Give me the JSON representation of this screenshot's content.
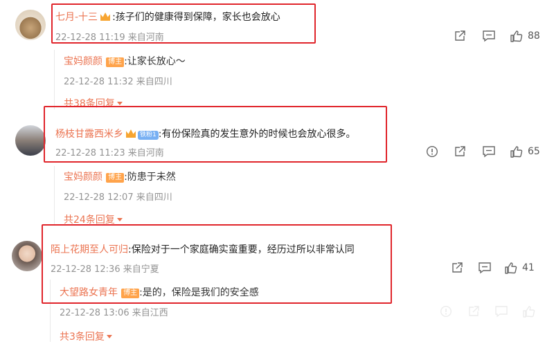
{
  "comments": [
    {
      "user": "七月-十三",
      "text": ":孩子们的健康得到保障，家长也会放心",
      "meta": "22-12-28 11:19 来自河南",
      "likes": "88",
      "reply": {
        "user": "宝妈颜颜",
        "badge": "博主",
        "text": ":让家长放心～",
        "meta": "22-12-28 11:32 来自四川"
      },
      "more": "共38条回复"
    },
    {
      "user": "杨枝甘露西米乡",
      "fan_badge": "铁粉1",
      "text": ":有份保险真的发生意外的时候也会放心很多。",
      "meta": "22-12-28 11:23 来自河南",
      "likes": "65",
      "reply": {
        "user": "宝妈颜颜",
        "badge": "博主",
        "text": ":防患于未然",
        "meta": "22-12-28 12:07 来自四川"
      },
      "more": "共24条回复"
    },
    {
      "user": "陌上花期至人可归",
      "text": ":保险对于一个家庭确实蛮重要，经历过所以非常认同",
      "meta": "22-12-28 12:36 来自宁夏",
      "likes": "41",
      "reply": {
        "user": "大望路女青年",
        "badge": "博主",
        "text": ":是的，保险是我们的安全感",
        "meta": "22-12-28 13:06 来自江西"
      },
      "more": "共3条回复"
    }
  ],
  "icons": [
    "share-icon",
    "comment-icon",
    "like-icon",
    "report-icon",
    "expand-arrow-icon"
  ],
  "colors": {
    "username": "#eb7350",
    "highlight_box": "#e0242a",
    "meta": "#939393",
    "bozhu_badge": "#ffa34a",
    "fan_badge": "#78b0f3"
  }
}
